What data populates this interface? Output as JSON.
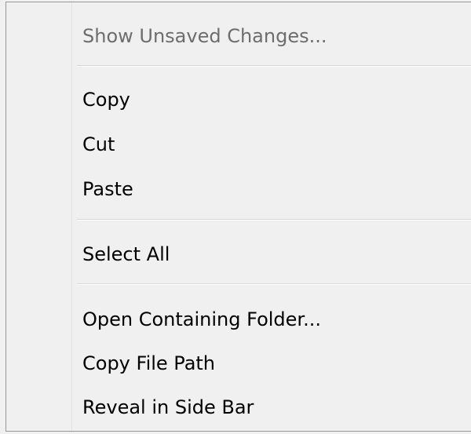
{
  "context_menu": {
    "groups": [
      {
        "items": [
          {
            "label": "Show Unsaved Changes...",
            "enabled": false
          }
        ]
      },
      {
        "items": [
          {
            "label": "Copy",
            "enabled": true
          },
          {
            "label": "Cut",
            "enabled": true
          },
          {
            "label": "Paste",
            "enabled": true
          }
        ]
      },
      {
        "items": [
          {
            "label": "Select All",
            "enabled": true
          }
        ]
      },
      {
        "items": [
          {
            "label": "Open Containing Folder...",
            "enabled": true
          },
          {
            "label": "Copy File Path",
            "enabled": true
          },
          {
            "label": "Reveal in Side Bar",
            "enabled": true
          }
        ]
      }
    ]
  },
  "colors": {
    "background": "#f0f0f0",
    "border": "#979797",
    "disabled_text": "#6d6d6d",
    "text": "#000000"
  }
}
